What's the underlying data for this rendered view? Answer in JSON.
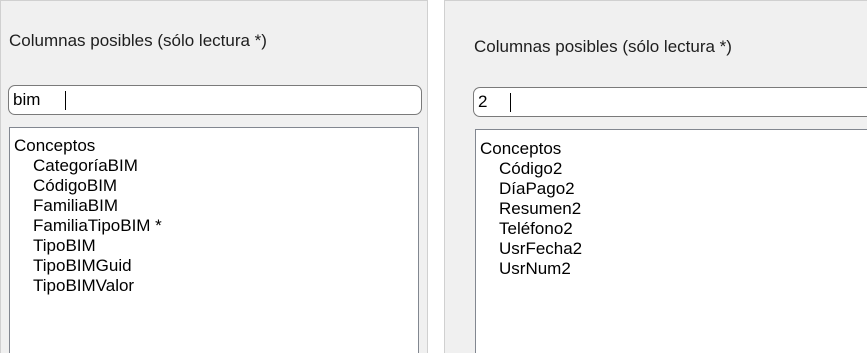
{
  "left_panel": {
    "label": "Columnas posibles (sólo lectura *)",
    "search_value": "bim",
    "group": "Conceptos",
    "items": [
      "CategoríaBIM",
      "CódigoBIM",
      "FamiliaBIM",
      "FamiliaTipoBIM *",
      "TipoBIM",
      "TipoBIMGuid",
      "TipoBIMValor"
    ]
  },
  "right_panel": {
    "label": "Columnas posibles (sólo lectura *)",
    "search_value": "2",
    "group": "Conceptos",
    "items": [
      "Código2",
      "DíaPago2",
      "Resumen2",
      "Teléfono2",
      "UsrFecha2",
      "UsrNum2"
    ]
  }
}
